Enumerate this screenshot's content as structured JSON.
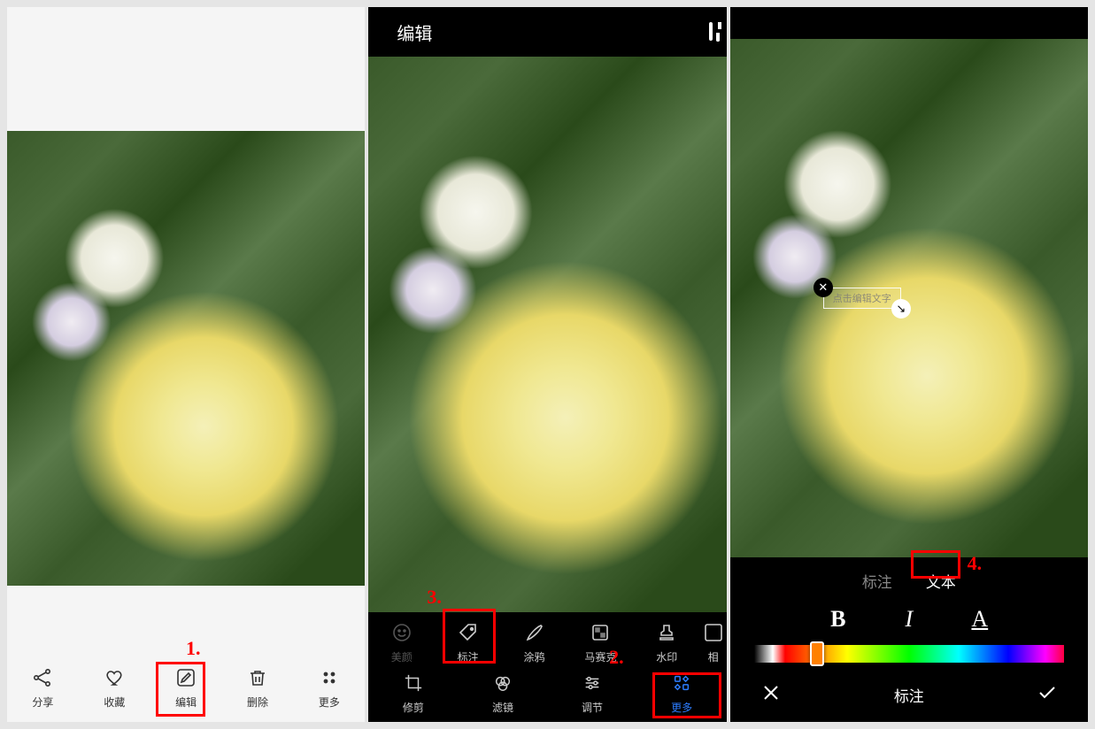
{
  "screen1": {
    "toolbar": {
      "share": "分享",
      "favorite": "收藏",
      "edit": "编辑",
      "delete": "删除",
      "more": "更多"
    },
    "step_label": "1."
  },
  "screen2": {
    "title": "编辑",
    "tools_top": {
      "beauty": "美颜",
      "annotate": "标注",
      "draw": "涂鸦",
      "mosaic": "马赛克",
      "watermark": "水印",
      "frame": "相"
    },
    "tools_bottom": {
      "crop": "修剪",
      "filter": "滤镜",
      "adjust": "调节",
      "more": "更多"
    },
    "step2_label": "2.",
    "step3_label": "3."
  },
  "screen3": {
    "tabs": {
      "annotate": "标注",
      "text": "文本"
    },
    "style": {
      "bold": "B",
      "italic": "I",
      "font": "A"
    },
    "overlay_placeholder": "点击编辑文字",
    "confirm_title": "标注",
    "step_label": "4."
  }
}
